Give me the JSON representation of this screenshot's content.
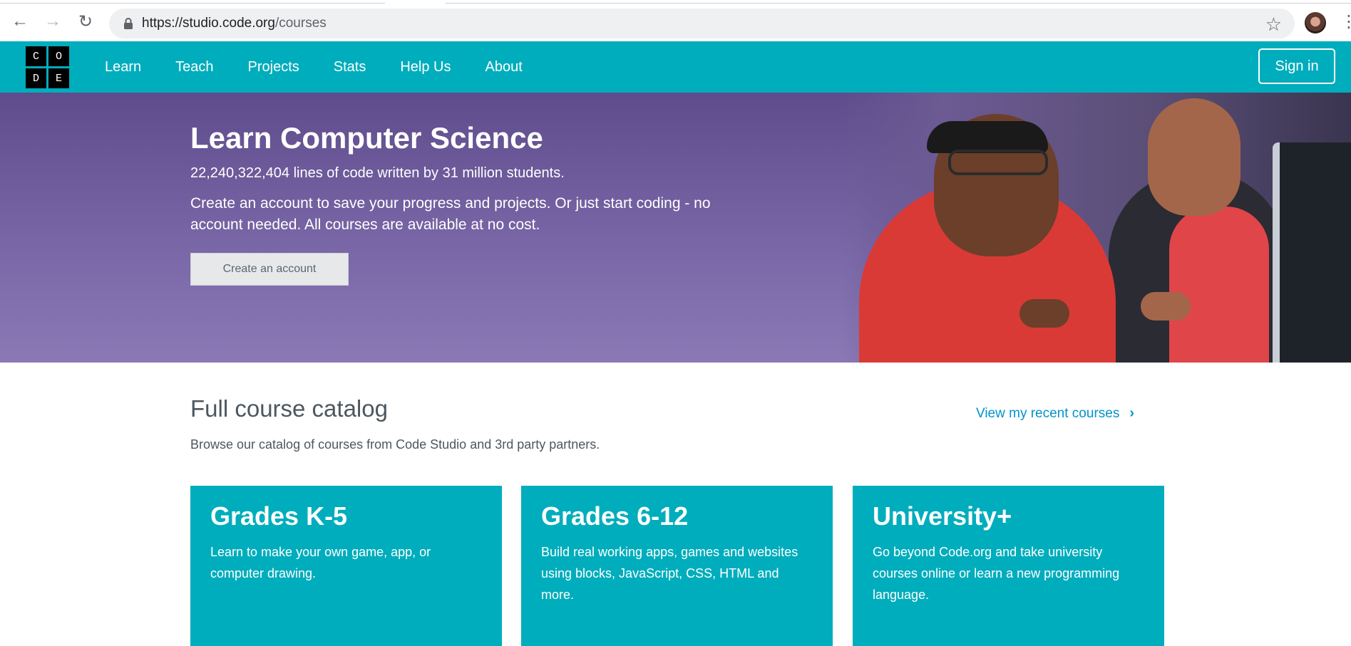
{
  "browser": {
    "url_host": "https://studio.code.org",
    "url_path": "/courses",
    "back_icon": "←",
    "forward_icon": "→",
    "reload_icon": "↻",
    "star_icon": "☆",
    "menu_icon": "⋮"
  },
  "header": {
    "logo_letters": [
      "C",
      "O",
      "D",
      "E"
    ],
    "nav": [
      "Learn",
      "Teach",
      "Projects",
      "Stats",
      "Help Us",
      "About"
    ],
    "signin_label": "Sign in",
    "brand_color": "#00adbc"
  },
  "hero": {
    "title": "Learn Computer Science",
    "stat": "22,240,322,404 lines of code written by 31 million students.",
    "description": "Create an account to save your progress and projects. Or just start coding - no account needed. All courses are available at no cost.",
    "create_label": "Create an account"
  },
  "catalog": {
    "title": "Full course catalog",
    "recent_link": "View my recent courses",
    "recent_chevron": "›",
    "description": "Browse our catalog of courses from Code Studio and 3rd party partners.",
    "cards": [
      {
        "title": "Grades K-5",
        "text": "Learn to make your own game, app, or computer drawing."
      },
      {
        "title": "Grades 6-12",
        "text": "Build real working apps, games and websites using blocks, JavaScript, CSS, HTML and more."
      },
      {
        "title": "University+",
        "text": "Go beyond Code.org and take university courses online or learn a new programming language."
      }
    ]
  }
}
